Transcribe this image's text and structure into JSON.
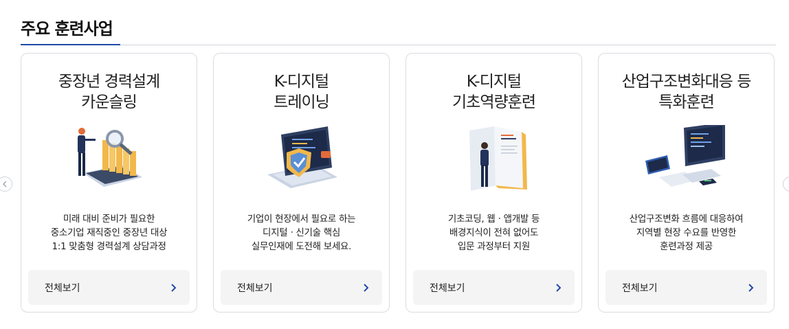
{
  "section": {
    "title": "주요 훈련사업"
  },
  "more_label": "전체보기",
  "colors": {
    "accent": "#1f4aa8",
    "arrow": "#1f4aa8"
  },
  "cards": [
    {
      "title_lines": [
        "중장년 경력설계",
        "카운슬링"
      ],
      "illustration": "counseling-illustration",
      "desc_lines": [
        "미래 대비 준비가 필요한",
        "중소기업 재직중인 중장년 대상",
        "1:1 맞춤형 경력설계 상담과정"
      ]
    },
    {
      "title_lines": [
        "K-디지털",
        "트레이닝"
      ],
      "illustration": "laptop-shield-illustration",
      "desc_lines": [
        "기업이 현장에서 필요로 하는",
        "디지털ㆍ신기술 핵심",
        "실무인재에 도전해 보세요."
      ]
    },
    {
      "title_lines": [
        "K-디지털",
        "기초역량훈련"
      ],
      "illustration": "manual-book-illustration",
      "desc_lines": [
        "기초코딩, 웹ㆍ앱개발 등",
        "배경지식이 전혀 없어도",
        "입문 과정부터 지원"
      ]
    },
    {
      "title_lines": [
        "산업구조변화대응 등",
        "특화훈련"
      ],
      "illustration": "devices-illustration",
      "desc_lines": [
        "산업구조변화 흐름에 대응하여",
        "지역별 현장 수요를 반영한",
        "훈련과정 제공"
      ]
    }
  ]
}
